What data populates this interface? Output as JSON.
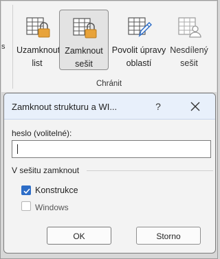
{
  "ribbon": {
    "left_stub": "s",
    "buttons": [
      {
        "line1": "Uzamknout",
        "line2": "list",
        "icon": "lock-sheet-icon"
      },
      {
        "line1": "Zamknout",
        "line2": "sešit",
        "icon": "lock-workbook-icon",
        "active": true
      },
      {
        "line1": "Povolit úpravy",
        "line2": "oblastí",
        "icon": "allow-edit-ranges-icon"
      },
      {
        "line1": "Nesdílený",
        "line2": "sešit",
        "icon": "unshare-workbook-icon"
      }
    ],
    "group_label": "Chránit"
  },
  "dialog": {
    "title": "Zamknout strukturu a WI...",
    "help": "?",
    "password_label": "heslo (volitelné):",
    "password_value": "",
    "section_label": "V sešitu zamknout",
    "options": [
      {
        "label": "Konstrukce",
        "checked": true
      },
      {
        "label": "Windows",
        "checked": false
      }
    ],
    "ok_label": "OK",
    "cancel_label": "Storno"
  },
  "colors": {
    "accent": "#2d6dc7",
    "lock": "#e8a33a",
    "titlebar": "#e8f0fb"
  }
}
